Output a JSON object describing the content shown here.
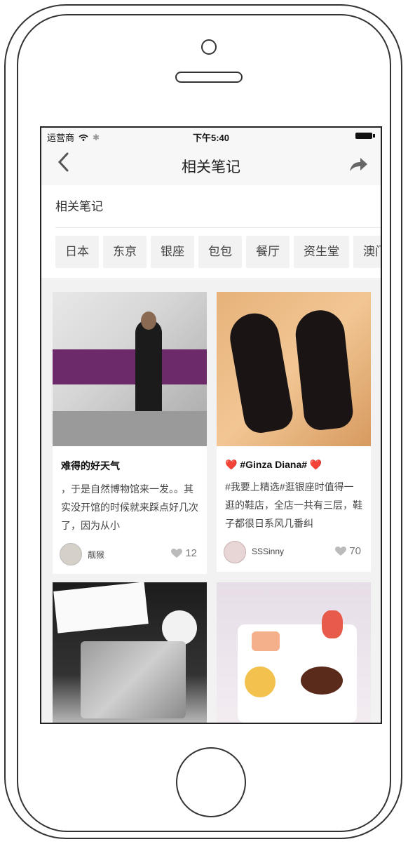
{
  "status_bar": {
    "carrier": "运营商",
    "time": "下午5:40"
  },
  "nav": {
    "title": "相关笔记"
  },
  "section": {
    "title": "相关笔记",
    "tags": [
      "日本",
      "东京",
      "银座",
      "包包",
      "餐厅",
      "资生堂",
      "澳门"
    ]
  },
  "cards": [
    {
      "title": "难得的好天气",
      "text": "，于是自然博物馆来一发。。其实没开馆的时候就来踩点好几次了，因为从小",
      "author": "靓猴",
      "likes": "12"
    },
    {
      "title": "❤️ #Ginza Diana# ❤️",
      "text": "#我要上精选#逛银座时值得一逛的鞋店，全店一共有三层，鞋子都很日系风几番纠",
      "author": "SSSinny",
      "likes": "70"
    },
    {
      "title": "",
      "text": "",
      "author": "",
      "likes": ""
    },
    {
      "title": "",
      "text": "",
      "author": "",
      "likes": ""
    }
  ],
  "icons": {
    "back": "chevron-left-icon",
    "share": "share-arrow-icon",
    "like": "heart-icon",
    "wifi": "wifi-icon",
    "battery": "battery-icon"
  },
  "colors": {
    "accent": "#e64545",
    "background": "#f2f2f2"
  }
}
